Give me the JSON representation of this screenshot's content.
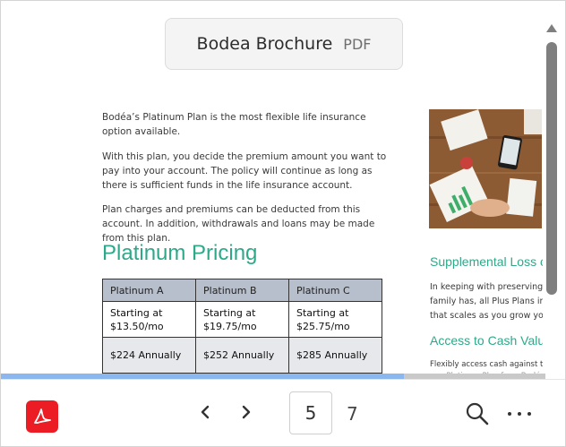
{
  "header": {
    "document_name": "Bodea Brochure",
    "document_type": "PDF"
  },
  "page": {
    "paragraphs": [
      "Bodéa’s Platinum Plan is the most flexible life insurance option available.",
      "With this plan, you decide the premium amount you want to pay into your account.  The policy will continue as long as there is sufficient funds in the life insurance account.",
      "Plan charges and premiums can be deducted from this account. In addition, withdrawals and loans may be made from this plan."
    ],
    "pricing_heading": "Platinum Pricing",
    "pricing_table": {
      "headers": [
        "Platinum A",
        "Platinum B",
        "Platinum C"
      ],
      "rows": [
        [
          "Starting at\n$13.50/mo",
          "Starting at\n$19.75/mo",
          "Starting at\n$25.75/mo"
        ],
        [
          "$224 Annually",
          "$252 Annually",
          "$285 Annually"
        ],
        [
          "",
          "",
          ""
        ]
      ]
    },
    "right_column": {
      "supplemental_heading": "Supplemental Loss c",
      "supplemental_lines": [
        "In keeping with preserving",
        "family has, all Plus Plans in",
        "that scales as you grow yo"
      ],
      "access_heading": "Access to Cash Valu",
      "access_lines": [
        "Flexibly access cash against th",
        "any Platinum Plan from Bodé"
      ]
    }
  },
  "progress": {
    "fraction": 0.74
  },
  "toolbar": {
    "current_page": "5",
    "total_pages": "7",
    "icons": {
      "acrobat": "adobe-acrobat-icon",
      "prev": "chevron-left-icon",
      "next": "chevron-right-icon",
      "search": "search-icon",
      "more": "more-horizontal-icon"
    },
    "acrobat_color": "#ec1c24"
  },
  "colors": {
    "heading_green": "#2fa88a",
    "table_header": "#b8bfcc",
    "progress_fill": "#8bb6ee"
  }
}
